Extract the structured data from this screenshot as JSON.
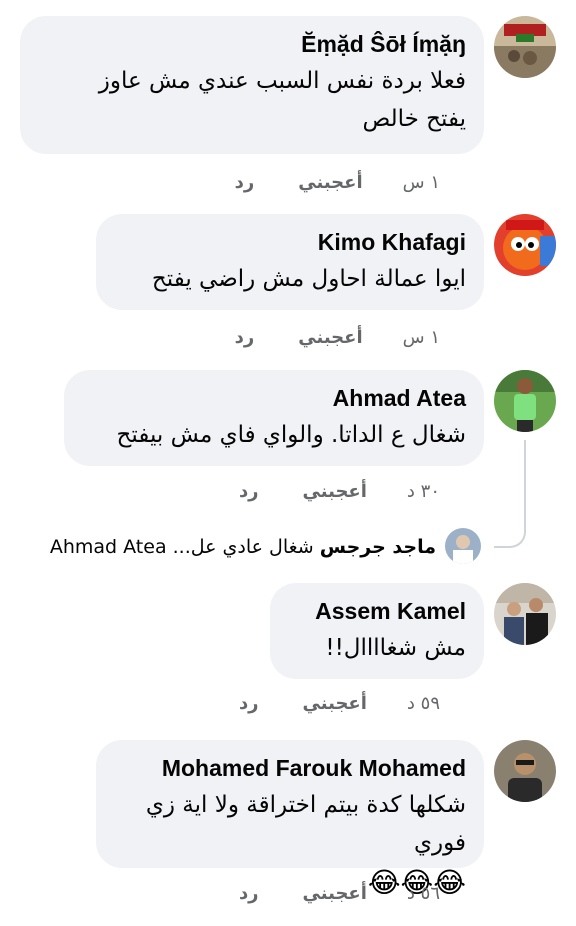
{
  "comments": [
    {
      "name": "Ĕṃặd Ŝōł Íṃặŋ",
      "text_line1": "فعلا بردة نفس السبب عندي مش عاوز",
      "text_line2": "يفتح خالص",
      "time": "١ س",
      "like": "أعجبني",
      "reply": "رد",
      "avatar": "profile-photo-crowd"
    },
    {
      "name": "Kimo Khafagi",
      "text_line1": "ايوا عمالة احاول مش راضي يفتح",
      "time": "١ س",
      "like": "أعجبني",
      "reply": "رد",
      "avatar": "profile-photo-cartoon"
    },
    {
      "name": "Ahmad Atea",
      "text_line1": "شغال ع الداتا. والواي فاي مش بيفتح",
      "time": "٣٠ د",
      "like": "أعجبني",
      "reply": "رد",
      "avatar": "profile-photo-green-shirt"
    },
    {
      "name": "Assem Kamel",
      "text_line1": "مش شغاااال!!",
      "time": "٥٩ د",
      "like": "أعجبني",
      "reply": "رد",
      "avatar": "profile-photo-two-men"
    },
    {
      "name": "Mohamed Farouk Mohamed",
      "text_line1": "شكلها كدة بيتم اختراقة ولا اية زي فوري",
      "emojis": "😂😂😂",
      "time": "٥٦ د",
      "like": "أعجبني",
      "reply": "رد",
      "avatar": "profile-photo-man-glasses"
    }
  ],
  "reply_preview": {
    "name": "ماجد جرجس",
    "snippet": "شغال عادي عل...",
    "mention": "Ahmad Atea"
  }
}
